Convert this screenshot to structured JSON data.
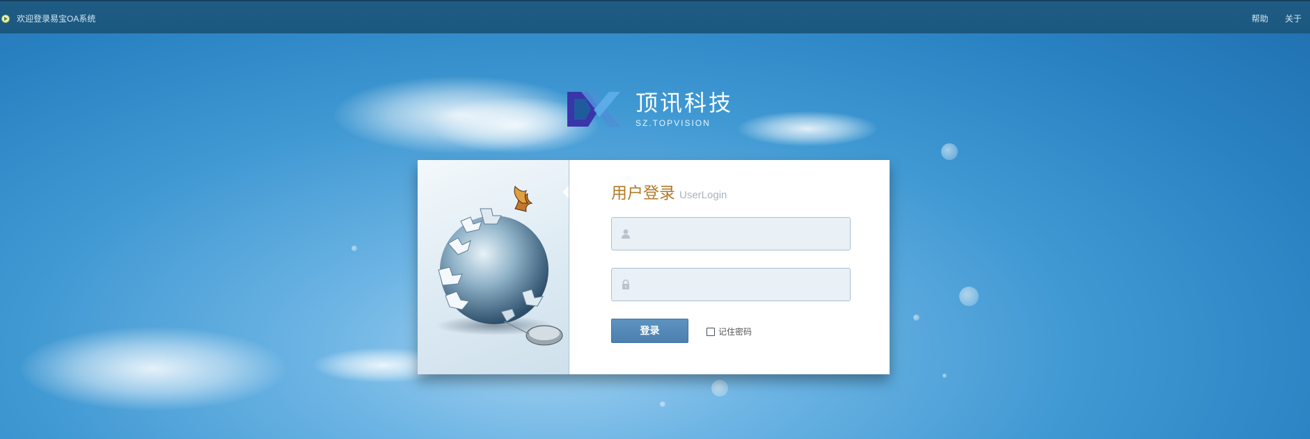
{
  "topbar": {
    "welcome": "欢迎登录易宝OA系统",
    "help": "帮助",
    "about": "关于"
  },
  "logo": {
    "name_cn": "顶讯科技",
    "name_en": "SZ.TOPVISION"
  },
  "login": {
    "title_cn": "用户登录",
    "title_en": "UserLogin",
    "username_value": "",
    "password_value": "",
    "submit_label": "登录",
    "remember_label": "记住密码"
  },
  "colors": {
    "topbar": "#1d5a83",
    "title_accent": "#b07a2a",
    "button": "#5288b6",
    "logo_blue": "#3a35a8"
  }
}
